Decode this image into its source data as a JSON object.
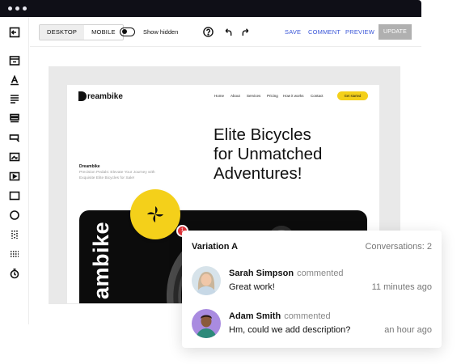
{
  "toolbar": {
    "device_tabs": [
      "DESKTOP",
      "MOBILE"
    ],
    "active_device": "DESKTOP",
    "toggle_label": "Show hidden",
    "actions": [
      "SAVE",
      "COMMENT",
      "PREVIEW"
    ],
    "update_label": "UPDATE"
  },
  "sidebar": {
    "tools": [
      "collapse-icon",
      "section-icon",
      "text-style-icon",
      "paragraph-icon",
      "list-icon",
      "input-icon",
      "image-icon",
      "video-icon",
      "container-icon",
      "circle-icon",
      "columns-icon",
      "divider-icon",
      "timer-icon"
    ]
  },
  "site": {
    "logo_text": "reambike",
    "nav": [
      "Home",
      "About",
      "Services",
      "Pricing",
      "How it works",
      "Contact"
    ],
    "cta": "Get started",
    "hero_lines": [
      "Elite Bicycles",
      "for Unmatched",
      "Adventures!"
    ],
    "brand": "Dreambike",
    "tagline": "Precision Pedals: Elevate Your Journey with Exquisite Elite Bicycles for Sale!",
    "vertical_word": "ambike"
  },
  "badge_count": "1",
  "colors": {
    "accent": "#f4d01a",
    "link": "#3a56d8",
    "badge": "#e0353a"
  },
  "panel": {
    "title": "Variation A",
    "count_label": "Conversations: 2",
    "comments": [
      {
        "name": "Sarah Simpson",
        "verb": "commented",
        "text": "Great work!",
        "time": "11 minutes ago"
      },
      {
        "name": "Adam Smith",
        "verb": "commented",
        "text": "Hm, could we add description?",
        "time": "an hour ago"
      }
    ]
  }
}
